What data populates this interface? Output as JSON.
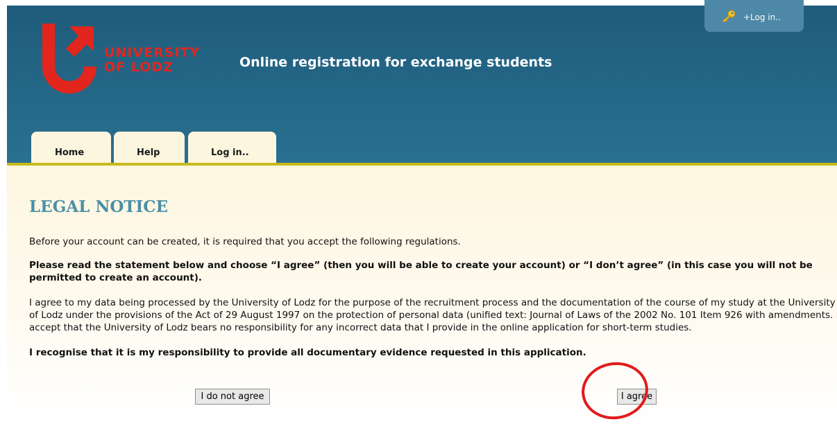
{
  "header": {
    "logo_line1": "UNIVERSITY",
    "logo_line2": "OF LODZ",
    "title": "Online registration for exchange students",
    "login_link": "+Log in.."
  },
  "tabs": [
    {
      "label": "Home"
    },
    {
      "label": "Help"
    },
    {
      "label": "Log in.."
    }
  ],
  "notice": {
    "title": "LEGAL NOTICE",
    "intro": "Before your account can be created, it is required that you accept the following regulations.",
    "instruction": "Please read the statement below and choose “I agree” (then you will be able to create your account) or “I don’t agree” (in this case you will not be permitted to create an account).",
    "statement": "I agree to my data being processed by the University of Lodz for the purpose of the recruitment process and the documentation of the course of my study at the University of Lodz under the provisions of the Act of 29 August 1997 on the protection of personal data (unified text: Journal of Laws of the 2002 No. 101 Item 926 with amendments. I accept that the University of Lodz bears no responsibility for any incorrect data that I provide in the online application for short-term studies.",
    "responsibility": "I recognise that it is my responsibility to provide all documentary evidence requested in this application."
  },
  "buttons": {
    "disagree": "I do not agree",
    "agree": "I agree"
  },
  "colors": {
    "header_bg": "#236484",
    "brand_red": "#e2261d",
    "tab_bg": "#fdf6df",
    "accent_line": "#c8ba1c",
    "notice_title": "#4a8fa8",
    "annotation_circle": "#e11b1b"
  }
}
